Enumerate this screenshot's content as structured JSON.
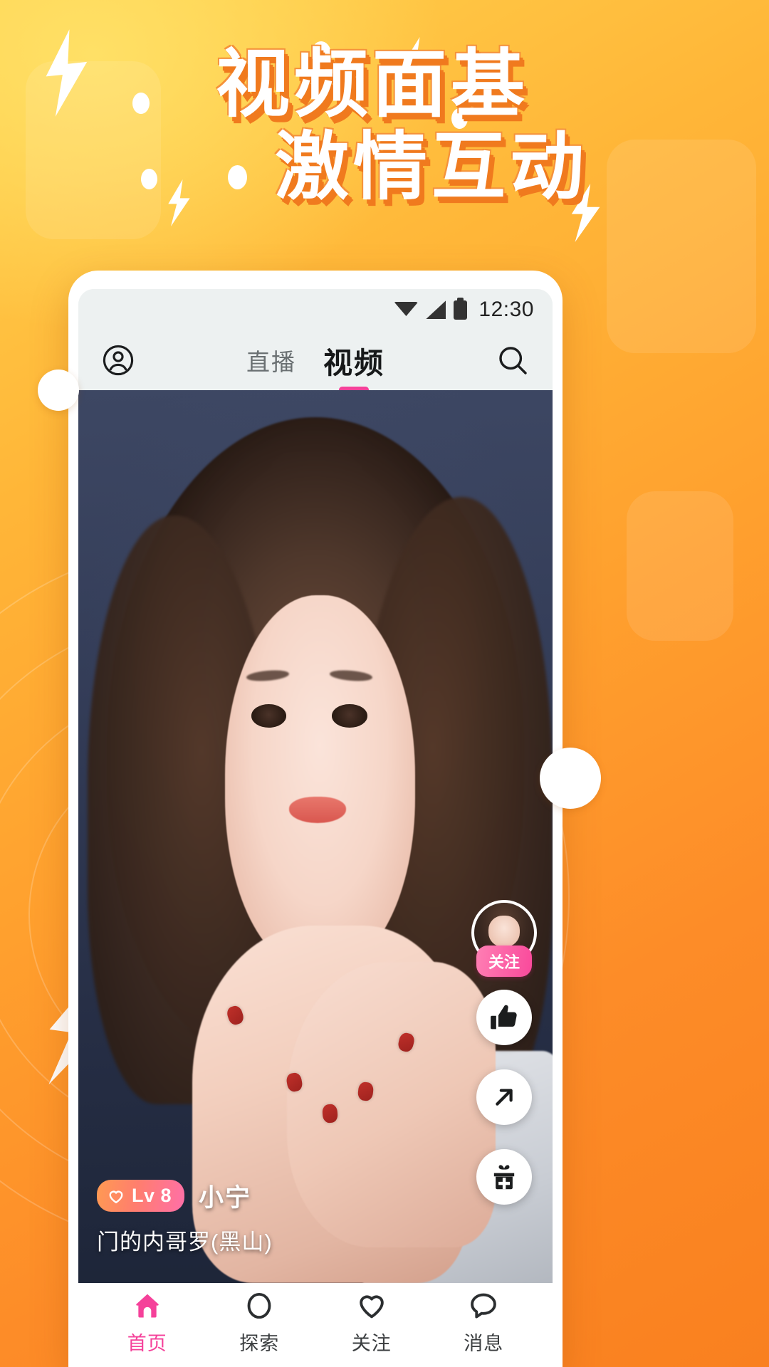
{
  "promo": {
    "headline_line1": "视频面基",
    "headline_line2": "激情互动"
  },
  "colors": {
    "bg_start": "#FFD34E",
    "bg_end": "#F9801F",
    "accent_pink": "#F5419A",
    "headline_fill": "#FFFFFF",
    "headline_shadow": "#F07A1E"
  },
  "phone": {
    "statusbar": {
      "time": "12:30",
      "wifi_icon": "wifi-icon",
      "signal_icon": "signal-icon",
      "battery_icon": "battery-icon"
    },
    "topnav": {
      "profile_icon": "user-circle-icon",
      "search_icon": "search-icon",
      "tabs": [
        {
          "label": "直播",
          "active": false
        },
        {
          "label": "视频",
          "active": true
        }
      ]
    },
    "rail": {
      "avatar_name": "avatar",
      "follow_label": "关注",
      "like_icon": "thumbs-up-icon",
      "share_icon": "share-arrow-icon",
      "gift_icon": "gift-add-icon"
    },
    "userinfo": {
      "level_icon": "heart-icon",
      "level_label": "Lv 8",
      "username": "小宁",
      "location": "门的内哥罗(黑山)"
    },
    "tabbar": [
      {
        "label": "首页",
        "icon": "home-icon",
        "active": true
      },
      {
        "label": "探索",
        "icon": "circle-explore-icon",
        "active": false
      },
      {
        "label": "关注",
        "icon": "heart-outline-icon",
        "active": false
      },
      {
        "label": "消息",
        "icon": "chat-bubble-icon",
        "active": false
      }
    ]
  }
}
